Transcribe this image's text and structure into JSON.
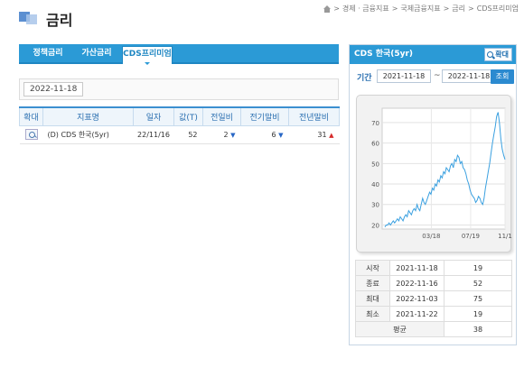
{
  "header": {
    "title": "금리",
    "breadcrumb": [
      "경제 · 금융지표",
      "국제금융지표",
      "금리",
      "CDS프리미엄"
    ],
    "breadcrumb_sep": ">"
  },
  "tabs": [
    {
      "label": "정책금리"
    },
    {
      "label": "가산금리"
    },
    {
      "label": "CDS프리미엄",
      "active": true
    }
  ],
  "filter": {
    "date": "2022-11-18"
  },
  "table": {
    "columns": [
      "확대",
      "지표명",
      "일자",
      "값(T)",
      "전일비",
      "전기말비",
      "전년말비"
    ],
    "rows": [
      {
        "name": "(D) CDS 한국(5yr)",
        "date": "22/11/16",
        "value": "52",
        "prev_day": "2",
        "prev_day_dir": "down",
        "prev_period": "6",
        "prev_period_dir": "down",
        "prev_year": "31",
        "prev_year_dir": "up"
      }
    ]
  },
  "panel": {
    "title": "CDS 한국(5yr)",
    "zoom_label": "확대",
    "period_label": "기간",
    "start": "2021-11-18",
    "tilde": "~",
    "end": "2022-11-18",
    "search_label": "조회"
  },
  "chart_data": {
    "type": "line",
    "x_ticks": [
      "03/18",
      "07/19",
      "11/1"
    ],
    "y_ticks": [
      20,
      30,
      40,
      50,
      60,
      70
    ],
    "ylim": [
      18,
      77
    ],
    "grid": true,
    "series": [
      {
        "values": [
          19,
          20,
          20,
          21,
          20,
          21,
          22,
          21,
          22,
          23,
          22,
          24,
          23,
          22,
          24,
          25,
          24,
          27,
          26,
          25,
          27,
          28,
          27,
          30,
          28,
          27,
          30,
          33,
          31,
          30,
          32,
          34,
          36,
          35,
          38,
          37,
          40,
          39,
          42,
          41,
          44,
          43,
          46,
          45,
          48,
          47,
          46,
          49,
          50,
          48,
          52,
          51,
          54,
          53,
          50,
          51,
          48,
          47,
          45,
          42,
          40,
          37,
          35,
          34,
          33,
          31,
          32,
          34,
          33,
          31,
          30,
          33,
          38,
          42,
          46,
          50,
          55,
          60,
          64,
          68,
          73,
          75,
          70,
          62,
          57,
          54,
          52
        ]
      }
    ],
    "line_color": "#3aa0e0"
  },
  "stats": {
    "rows": [
      {
        "label": "시작",
        "date": "2021-11-18",
        "value": "19"
      },
      {
        "label": "종료",
        "date": "2022-11-16",
        "value": "52"
      },
      {
        "label": "최대",
        "date": "2022-11-03",
        "value": "75"
      },
      {
        "label": "최소",
        "date": "2021-11-22",
        "value": "19"
      }
    ],
    "avg_label": "평균",
    "avg_value": "38"
  },
  "arrows": {
    "down": "▼",
    "up": "▲"
  }
}
